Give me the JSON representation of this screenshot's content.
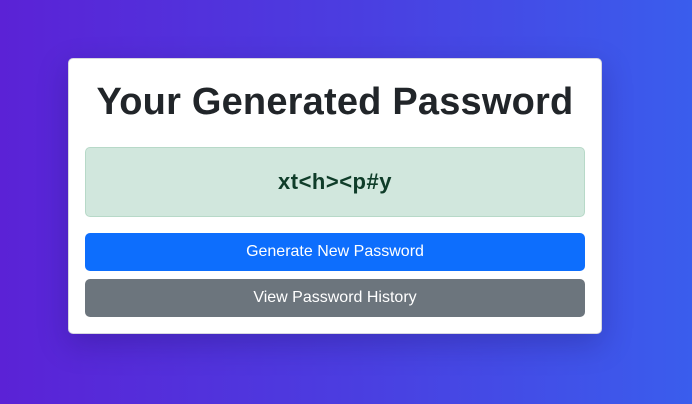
{
  "card": {
    "title": "Your Generated Password",
    "password": "xt<h><p#y",
    "generate_label": "Generate New Password",
    "history_label": "View Password History"
  },
  "colors": {
    "primary_button": "#0d6efd",
    "secondary_button": "#6c757d",
    "password_background": "#d1e7dd",
    "background_gradient_start": "#5b22d6",
    "background_gradient_end": "#3a5ded"
  }
}
